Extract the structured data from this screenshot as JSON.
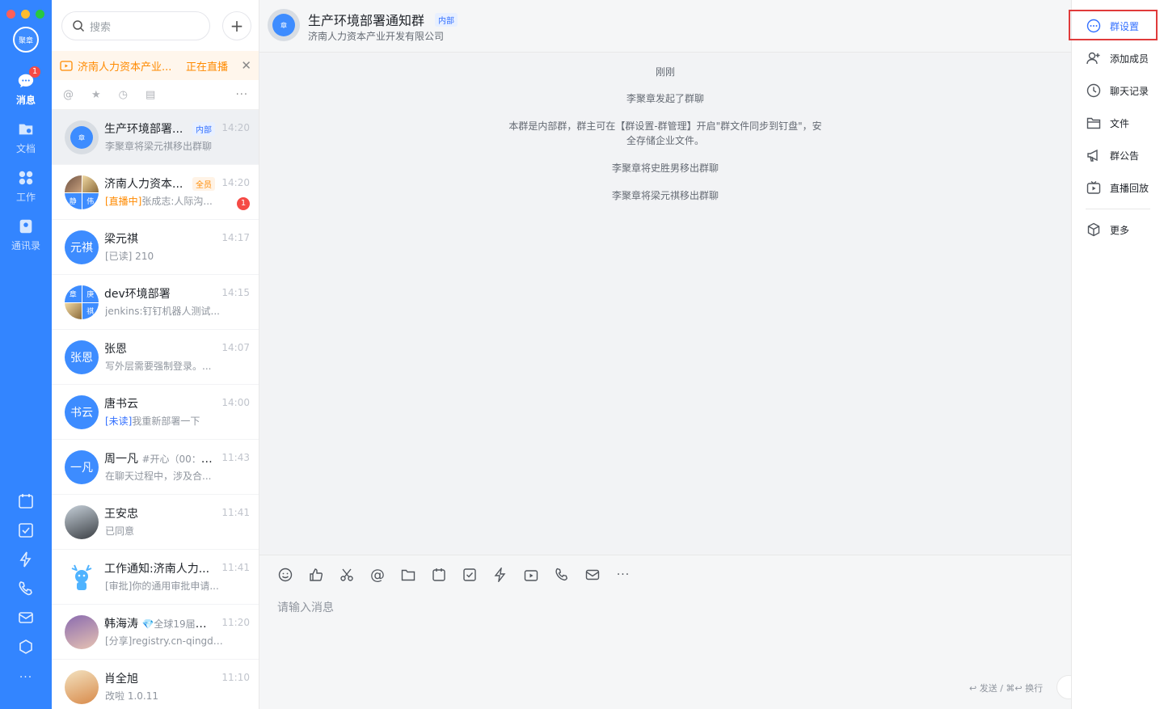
{
  "window": {
    "traffic_lights": [
      "close",
      "minimize",
      "zoom"
    ]
  },
  "rail": {
    "avatar_text": "聚章",
    "nav": [
      {
        "key": "messages",
        "label": "消息",
        "icon": "chat-bubble-icon",
        "badge": "1",
        "active": true
      },
      {
        "key": "docs",
        "label": "文档",
        "icon": "folder-doc-icon"
      },
      {
        "key": "work",
        "label": "工作",
        "icon": "grid-apps-icon"
      },
      {
        "key": "contacts",
        "label": "通讯录",
        "icon": "contacts-book-icon"
      }
    ],
    "bottom_icons": [
      "calendar-icon",
      "todo-check-icon",
      "lightning-icon",
      "phone-icon",
      "mail-icon",
      "cube-icon"
    ],
    "more": "···"
  },
  "convlist": {
    "search_placeholder": "搜索",
    "live_banner": {
      "title": "济南人力资本产业...",
      "status": "正在直播"
    },
    "filter_more": "···",
    "items": [
      {
        "name": "生产环境部署...",
        "tag": "内部",
        "tag_type": "int",
        "time": "14:20",
        "preview": "李聚章将梁元祺移出群聊",
        "avatar_text": "章",
        "active": true
      },
      {
        "name": "济南人力资本...",
        "tag": "全员",
        "tag_type": "all",
        "time": "14:20",
        "preview_hl": "[直播中]",
        "preview": "张成志:人际沟...",
        "badge": "1",
        "avatar_quad": [
          "",
          "",
          "静",
          "伟"
        ]
      },
      {
        "name": "梁元祺",
        "time": "14:17",
        "preview": "[已读] 210",
        "avatar_text": "元祺"
      },
      {
        "name": "dev环境部署",
        "time": "14:15",
        "preview": "jenkins:钉钉机器人测试...",
        "avatar_quad": [
          "章",
          "庚",
          "",
          "祺"
        ]
      },
      {
        "name": "张恩",
        "time": "14:07",
        "preview": "写外层需要强制登录。...",
        "avatar_text": "张恩"
      },
      {
        "name": "唐书云",
        "time": "14:00",
        "preview_hl_blue": "[未读]",
        "preview": "我重新部署一下",
        "avatar_text": "书云"
      },
      {
        "name": "周一凡",
        "name_extra": "#开心（00：0...",
        "time": "11:43",
        "preview": "在聊天过程中，涉及合...",
        "avatar_text": "一凡"
      },
      {
        "name": "王安忠",
        "time": "11:41",
        "preview": "已同意",
        "avatar_text": ""
      },
      {
        "name": "工作通知:济南人力...",
        "time": "11:41",
        "preview": "[审批]你的通用审批申请...",
        "avatar_text": ""
      },
      {
        "name": "韩海涛",
        "name_extra": "💎全球19届熬...",
        "time": "11:20",
        "preview": "[分享]registry.cn-qingda...",
        "avatar_text": ""
      },
      {
        "name": "肖全旭",
        "time": "11:10",
        "preview": "改啦 1.0.11",
        "avatar_text": ""
      }
    ]
  },
  "chat": {
    "title": "生产环境部署通知群",
    "title_tag": "内部",
    "subtitle": "济南人力资本产业开发有限公司",
    "avatar_text": "章",
    "messages": [
      "刚刚",
      "李聚章发起了群聊",
      "本群是内部群，群主可在【群设置-群管理】开启\"群文件同步到钉盘\"，安",
      "全存储企业文件。",
      "李聚章将史胜男移出群聊",
      "李聚章将梁元祺移出群聊"
    ],
    "toolbar_icons": [
      "emoji-icon",
      "thumbs-up-icon",
      "scissors-icon",
      "at-icon",
      "folder-icon",
      "calendar-icon",
      "todo-check-icon",
      "lightning-icon",
      "live-tv-icon",
      "phone-icon",
      "mail-icon",
      "more-icon"
    ],
    "input_placeholder": "请输入消息",
    "send_hint": "↩ 发送 / ⌘↩ 换行"
  },
  "rpanel": {
    "items": [
      {
        "label": "群设置",
        "icon": "more-circle-icon",
        "active": true
      },
      {
        "label": "添加成员",
        "icon": "add-user-icon"
      },
      {
        "label": "聊天记录",
        "icon": "clock-icon"
      },
      {
        "label": "文件",
        "icon": "folder-icon"
      },
      {
        "label": "群公告",
        "icon": "megaphone-icon"
      },
      {
        "label": "直播回放",
        "icon": "live-tv-icon"
      },
      {
        "label": "更多",
        "icon": "cube-icon"
      }
    ]
  },
  "colors": {
    "brand": "#3385ff",
    "accent": "#3370ff",
    "warning": "#ff8a00",
    "badge": "#f54a45",
    "highlight_box": "#e03b3b"
  }
}
